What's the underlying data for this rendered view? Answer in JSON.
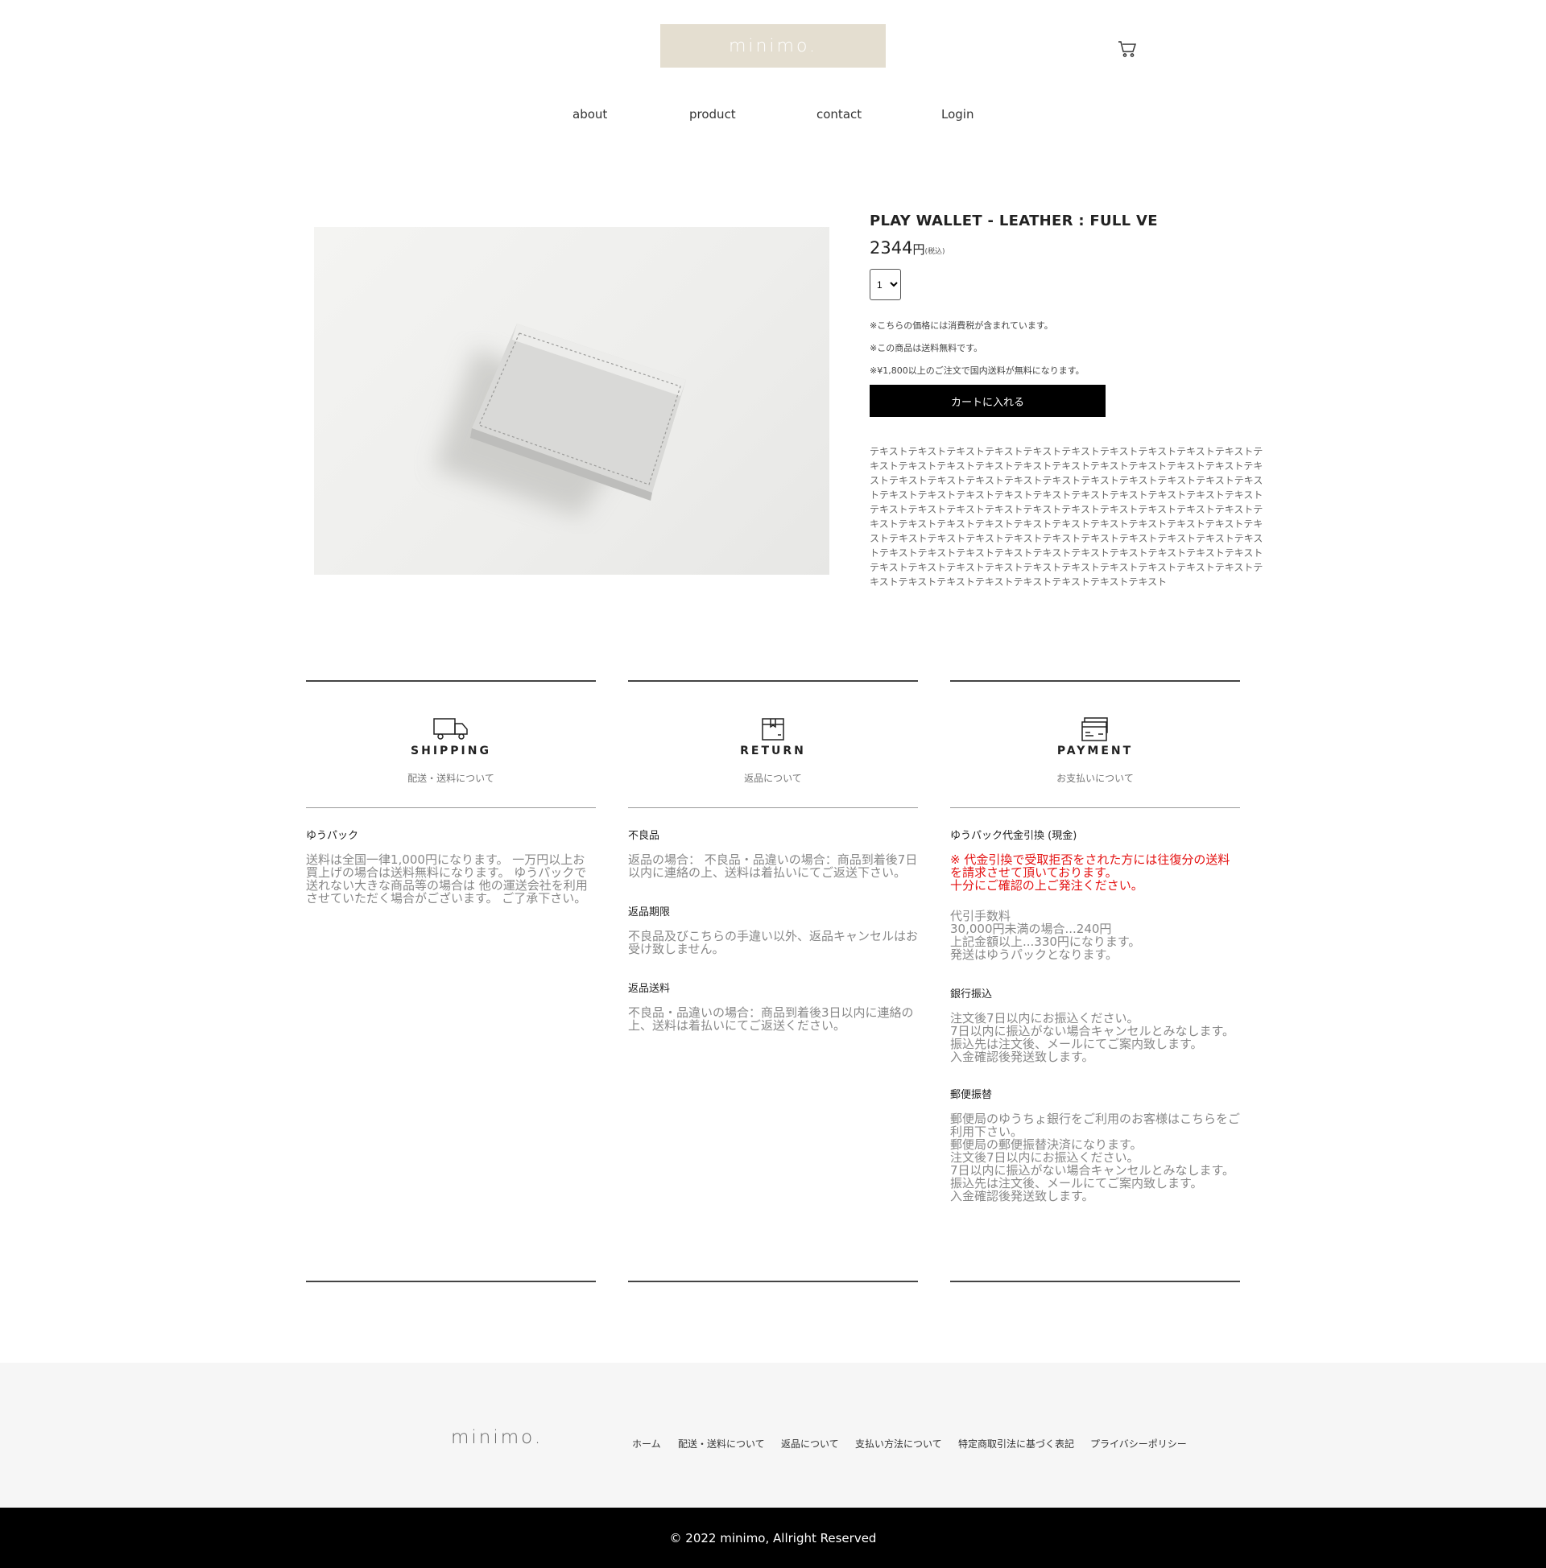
{
  "header": {
    "logo": "minimo.",
    "nav": [
      "about",
      "product",
      "contact",
      "Login"
    ]
  },
  "product": {
    "title": "PLAY WALLET - LEATHER : FULL VE",
    "price": "2344",
    "yen": "円",
    "tax_label": "(税込)",
    "quantity": "1",
    "notes": [
      "※こちらの価格には消費税が含まれています。",
      "※この商品は送料無料です。",
      "※¥1,800以上のご注文で国内送料が無料になります。"
    ],
    "cart_button": "カートに入れる",
    "description": "テキストテキストテキストテキストテキストテキストテキストテキストテキストテキストテキストテキストテキストテキストテキストテキストテキストテキストテキストテキストテキストテキストテキストテキストテキストテキストテキストテキストテキストテキストテキストテキストテキストテキストテキストテキストテキストテキストテキストテキストテキストテキストテキストテキストテキストテキストテキストテキストテキストテキストテキストテキストテキストテキストテキストテキストテキストテキストテキストテキストテキストテキストテキストテキストテキストテキストテキストテキストテキストテキストテキストテキストテキストテキストテキストテキストテキストテキストテキストテキストテキストテキストテキストテキストテキストテキストテキストテキストテキストテキストテキストテキストテキストテキストテキストテキストテキストテキストテキストテキスト"
  },
  "shipping": {
    "heading": "SHIPPING",
    "subtitle": "配送・送料について",
    "icon": "truck-icon",
    "items": [
      {
        "title": "ゆうパック",
        "text": "送料は全国一律1,000円になります。 一万円以上お買上げの場合は送料無料になります。 ゆうパックで送れない大きな商品等の場合は 他の運送会社を利用させていただく場合がございます。 ご了承下さい。"
      }
    ]
  },
  "return": {
    "heading": "RETURN",
    "subtitle": "返品について",
    "icon": "box-icon",
    "items": [
      {
        "title": "不良品",
        "text": "返品の場合： 不良品・品違いの場合：商品到着後7日以内に連絡の上、送料は着払いにてご返送下さい。"
      },
      {
        "title": "返品期限",
        "text": "不良品及びこちらの手違い以外、返品キャンセルはお受け致しません。"
      },
      {
        "title": "返品送料",
        "text": "不良品・品違いの場合：商品到着後3日以内に連絡の上、送料は着払いにてご返送ください。"
      }
    ]
  },
  "payment": {
    "heading": "PAYMENT",
    "subtitle": "お支払いについて",
    "icon": "credit-card-icon",
    "cod_title": "ゆうパック代金引換 (現金)",
    "cod_warning": "※ 代金引換で受取拒否をされた方には往復分の送料を請求させて頂いております。\n十分にご確認の上ご発注ください。",
    "cod_text": "代引手数料\n30,000円未満の場合...240円\n上記金額以上...330円になります。\n発送はゆうパックとなります。",
    "bank_title": "銀行振込",
    "bank_text": "注文後7日以内にお振込ください。\n7日以内に振込がない場合キャンセルとみなします。\n振込先は注文後、メールにてご案内致します。\n入金確認後発送致します。",
    "postal_title": "郵便振替",
    "postal_text": "郵便局のゆうちょ銀行をご利用のお客様はこちらをご利用下さい。\n郵便局の郵便振替決済になります。\n注文後7日以内にお振込ください。\n7日以内に振込がない場合キャンセルとみなします。\n振込先は注文後、メールにてご案内致します。\n入金確認後発送致します。"
  },
  "footer": {
    "logo": "minimo.",
    "links": [
      "ホーム",
      "配送・送料について",
      "返品について",
      "支払い方法について",
      "特定商取引法に基づく表記",
      "プライバシーポリシー"
    ],
    "copyright": "© 2022 minimo, Allright Reserved"
  },
  "colors": {
    "logo_bg": "#e4ded0",
    "warning": "#e41313",
    "button_bg": "#000000",
    "footer_bg": "#f6f6f6"
  }
}
